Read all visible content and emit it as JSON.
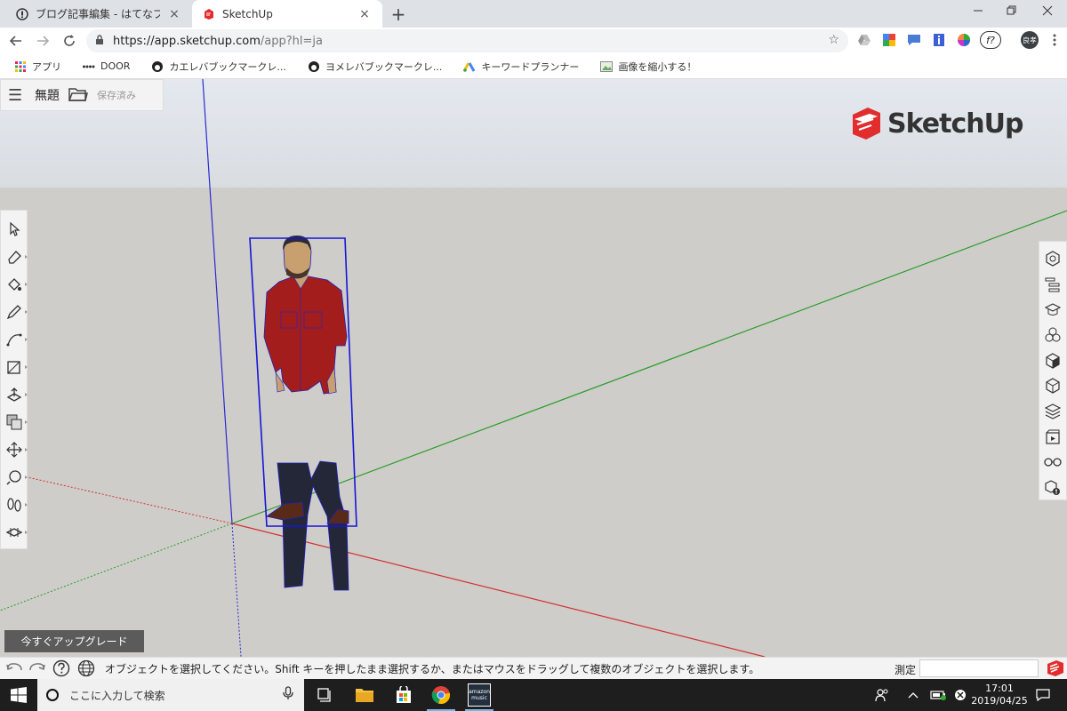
{
  "browser": {
    "tabs": [
      {
        "title": "ブログ記事編集 - はてなブログ",
        "active": false
      },
      {
        "title": "SketchUp",
        "active": true
      }
    ],
    "close_glyph": "×",
    "new_tab_glyph": "+",
    "url_host": "https://app.sketchup.com",
    "url_path": "/app?hl=ja",
    "bookmarks": [
      "アプリ",
      "DOOR",
      "カエレバブックマークレ...",
      "ヨメレバブックマークレ...",
      "キーワードプランナー",
      "画像を縮小する！"
    ],
    "profile_initials": "良孝",
    "ext_f_label": "f?"
  },
  "app": {
    "file_name": "無題",
    "save_status": "保存済み",
    "logo_text": "SketchUp",
    "upgrade_label": "今すぐアップグレード",
    "status_hint": "オブジェクトを選択してください。Shift キーを押したまま選択するか、またはマウスをドラッグして複数のオブジェクトを選択します。",
    "measure_label": "測定",
    "measure_value": "",
    "left_tools": [
      "select-icon",
      "eraser-icon",
      "paint-bucket-icon",
      "pencil-icon",
      "arc-icon",
      "rectangle-icon",
      "push-pull-icon",
      "offset-icon",
      "move-icon",
      "tape-measure-icon",
      "walk-icon",
      "section-plane-icon"
    ],
    "right_tools": [
      "entity-info-icon",
      "outliner-icon",
      "instructor-icon",
      "components-icon",
      "materials-icon",
      "styles-icon",
      "layers-icon",
      "scenes-icon",
      "display-icon",
      "solid-inspector-icon"
    ],
    "colors": {
      "axis_red": "#d23232",
      "axis_green": "#2a9e2a",
      "axis_blue": "#2a2ad0",
      "shirt": "#a41d1d",
      "jeans": "#232737",
      "sky": "#dfe4ea",
      "ground": "#cfcdc9"
    }
  },
  "taskbar": {
    "search_placeholder": "ここに入力して検索",
    "time": "17:01",
    "date": "2019/04/25",
    "apps": [
      "task-view-icon",
      "file-explorer-icon",
      "store-icon",
      "chrome-icon",
      "amazon-music-icon"
    ],
    "amazon_label": "amazon music"
  }
}
